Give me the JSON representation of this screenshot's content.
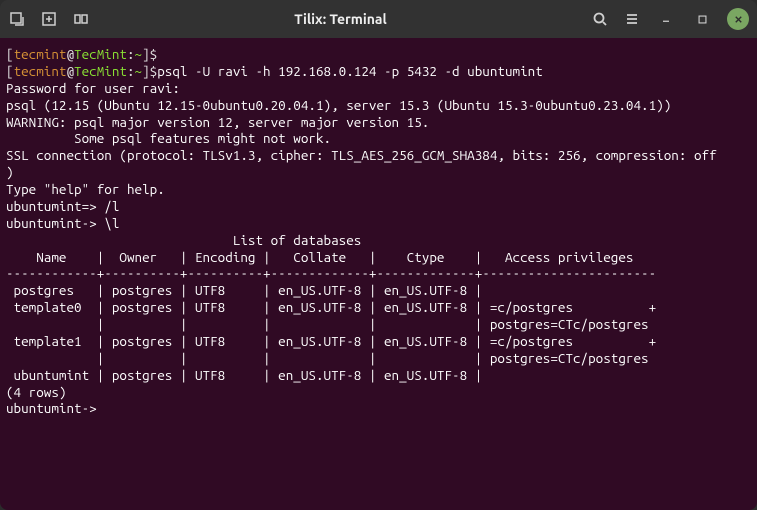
{
  "titlebar": {
    "title": "Tilix: Terminal"
  },
  "prompt": {
    "user": "tecmint",
    "host": "TecMint",
    "path": "~",
    "symbol": "$"
  },
  "lines": {
    "cmd1": "",
    "cmd2": "psql -U ravi -h 192.168.0.124 -p 5432 -d ubuntumint",
    "l3": "Password for user ravi:",
    "l4": "psql (12.15 (Ubuntu 12.15-0ubuntu0.20.04.1), server 15.3 (Ubuntu 15.3-0ubuntu0.23.04.1))",
    "l5": "WARNING: psql major version 12, server major version 15.",
    "l6": "         Some psql features might not work.",
    "l7": "SSL connection (protocol: TLSv1.3, cipher: TLS_AES_256_GCM_SHA384, bits: 256, compression: off",
    "l8": ")",
    "l9": "Type \"help\" for help.",
    "l10": "",
    "l11": "ubuntumint=> /l",
    "l12": "ubuntumint-> \\l",
    "l13": "                              List of databases",
    "l14": "    Name    |  Owner   | Encoding |   Collate   |    Ctype    |   Access privileges",
    "l15": "------------+----------+----------+-------------+-------------+-----------------------",
    "l16": " postgres   | postgres | UTF8     | en_US.UTF-8 | en_US.UTF-8 |",
    "l17": " template0  | postgres | UTF8     | en_US.UTF-8 | en_US.UTF-8 | =c/postgres          +",
    "l18": "            |          |          |             |             | postgres=CTc/postgres",
    "l19": " template1  | postgres | UTF8     | en_US.UTF-8 | en_US.UTF-8 | =c/postgres          +",
    "l20": "            |          |          |             |             | postgres=CTc/postgres",
    "l21": " ubuntumint | postgres | UTF8     | en_US.UTF-8 | en_US.UTF-8 |",
    "l22": "(4 rows)",
    "l23": "",
    "l24": "ubuntumint->"
  },
  "chart_data": {
    "type": "table",
    "title": "List of databases",
    "columns": [
      "Name",
      "Owner",
      "Encoding",
      "Collate",
      "Ctype",
      "Access privileges"
    ],
    "rows": [
      {
        "Name": "postgres",
        "Owner": "postgres",
        "Encoding": "UTF8",
        "Collate": "en_US.UTF-8",
        "Ctype": "en_US.UTF-8",
        "Access privileges": ""
      },
      {
        "Name": "template0",
        "Owner": "postgres",
        "Encoding": "UTF8",
        "Collate": "en_US.UTF-8",
        "Ctype": "en_US.UTF-8",
        "Access privileges": "=c/postgres + postgres=CTc/postgres"
      },
      {
        "Name": "template1",
        "Owner": "postgres",
        "Encoding": "UTF8",
        "Collate": "en_US.UTF-8",
        "Ctype": "en_US.UTF-8",
        "Access privileges": "=c/postgres + postgres=CTc/postgres"
      },
      {
        "Name": "ubuntumint",
        "Owner": "postgres",
        "Encoding": "UTF8",
        "Collate": "en_US.UTF-8",
        "Ctype": "en_US.UTF-8",
        "Access privileges": ""
      }
    ],
    "row_count_label": "(4 rows)"
  }
}
